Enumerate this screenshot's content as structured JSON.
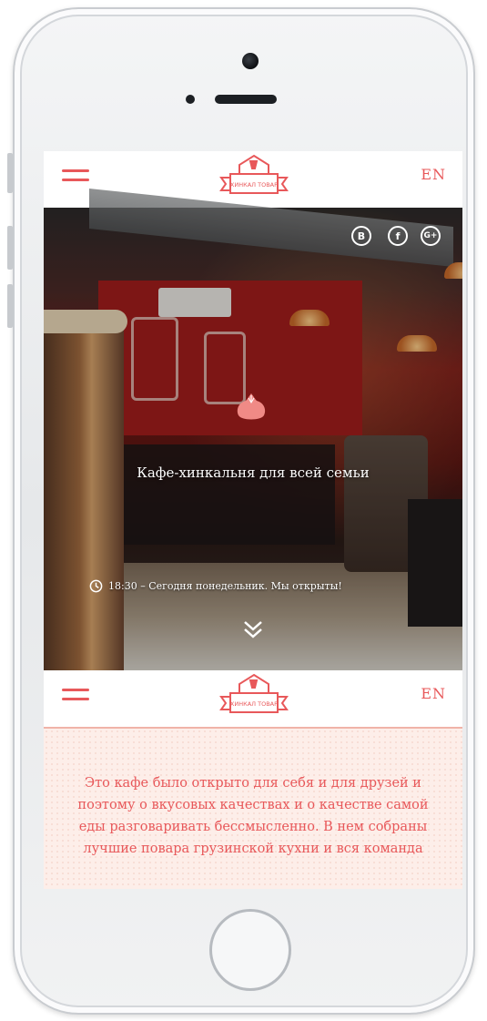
{
  "header": {
    "lang_label": "EN",
    "logo_text": "ХИНКАЛ ТОВАР"
  },
  "hero": {
    "social": [
      {
        "icon": "vk-icon",
        "label": "B"
      },
      {
        "icon": "facebook-icon",
        "label": "f"
      },
      {
        "icon": "google-plus-icon",
        "label": "G+"
      }
    ],
    "tagline": "Кафе-хинкальня для всей семьи",
    "status_text": "18:30 – Сегодня понедельник. Мы открыты!"
  },
  "header2": {
    "lang_label": "EN"
  },
  "about": {
    "text": "Это кафе было открыто для себя и для друзей и поэтому о вкусовых качествах и о качестве самой еды разговаривать бессмысленно. В нем собраны лучшие повара грузинской кухни и вся команда"
  },
  "colors": {
    "accent": "#e8585a",
    "content_bg": "#fdeee9"
  }
}
